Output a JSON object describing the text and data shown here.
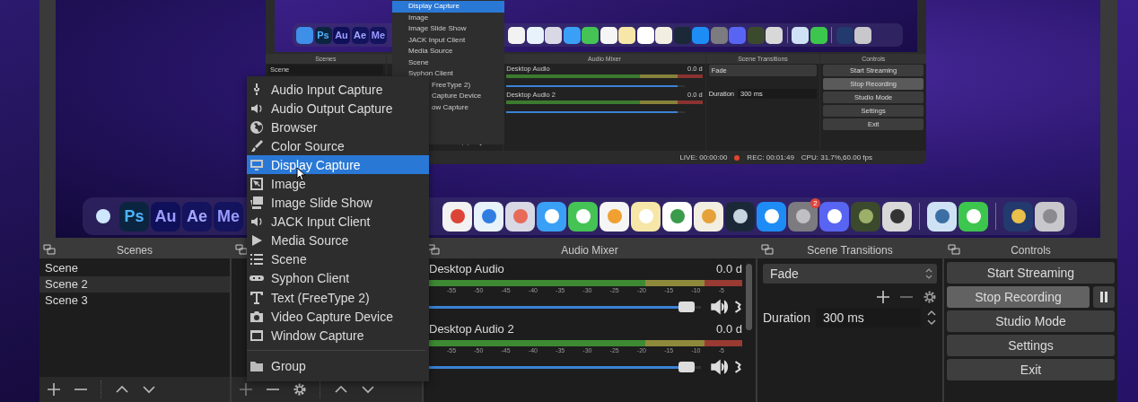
{
  "preview": {
    "dock": {
      "labels": [
        "Ps",
        "Au",
        "Ae",
        "Me"
      ],
      "badge": "2"
    },
    "captured_window": {
      "dock": {
        "labels": [
          "Ps",
          "Au",
          "Ae",
          "Me"
        ]
      },
      "menu": [
        {
          "label": "Display Capture",
          "selected": true
        },
        {
          "label": "Image",
          "selected": false
        },
        {
          "label": "Image Slide Show",
          "selected": false
        },
        {
          "label": "JACK Input Client",
          "selected": false
        },
        {
          "label": "Media Source",
          "selected": false
        },
        {
          "label": "Scene",
          "selected": false
        },
        {
          "label": "Syphon Client",
          "selected": false
        }
      ],
      "menu_covered_items": [
        "FreeType 2)",
        "Capture Device",
        "ow Capture"
      ],
      "scenes": {
        "title": "Scenes",
        "items": [
          "Scene"
        ]
      },
      "audio_mixer": {
        "title": "Audio Mixer",
        "channels": [
          {
            "name": "Desktop Audio",
            "reading": "0.0 d",
            "level": 0.96
          },
          {
            "name": "Desktop Audio 2",
            "reading": "0.0 d",
            "level": 0.96
          }
        ]
      },
      "scene_transitions": {
        "title": "Scene Transitions",
        "transition": "Fade",
        "duration_label": "Duration",
        "duration": "300 ms"
      },
      "controls": {
        "title": "Controls",
        "buttons": [
          {
            "label": "Start Streaming",
            "active": false
          },
          {
            "label": "Stop Recording",
            "active": true
          },
          {
            "label": "Studio Mode",
            "active": false
          },
          {
            "label": "Settings",
            "active": false
          },
          {
            "label": "Exit",
            "active": false
          }
        ]
      },
      "status_bar": {
        "live": "LIVE: 00:00:00",
        "rec": "REC: 00:01:49",
        "cpu": "CPU: 31.7%,60.00 fps"
      }
    }
  },
  "add_source_menu": {
    "items": [
      {
        "label": "Audio Input Capture",
        "selected": false
      },
      {
        "label": "Audio Output Capture",
        "selected": false
      },
      {
        "label": "Browser",
        "selected": false
      },
      {
        "label": "Color Source",
        "selected": false
      },
      {
        "label": "Display Capture",
        "selected": true
      },
      {
        "label": "Image",
        "selected": false
      },
      {
        "label": "Image Slide Show",
        "selected": false
      },
      {
        "label": "JACK Input Client",
        "selected": false
      },
      {
        "label": "Media Source",
        "selected": false
      },
      {
        "label": "Scene",
        "selected": false
      },
      {
        "label": "Syphon Client",
        "selected": false
      },
      {
        "label": "Text (FreeType 2)",
        "selected": false
      },
      {
        "label": "Video Capture Device",
        "selected": false
      },
      {
        "label": "Window Capture",
        "selected": false
      }
    ],
    "group_item": {
      "label": "Group",
      "selected": false
    }
  },
  "scenes": {
    "title": "Scenes",
    "items": [
      {
        "label": "Scene",
        "selected": false
      },
      {
        "label": "Scene 2",
        "selected": true
      },
      {
        "label": "Scene 3",
        "selected": false
      }
    ]
  },
  "audio_mixer": {
    "title": "Audio Mixer",
    "channels": [
      {
        "name": "Desktop Audio",
        "reading": "0.0 d",
        "level": 0.97,
        "scale": [
          "-55",
          "-50",
          "-45",
          "-40",
          "-35",
          "-30",
          "-25",
          "-20",
          "-15",
          "-10",
          "-5"
        ]
      },
      {
        "name": "Desktop Audio 2",
        "reading": "0.0 d",
        "level": 0.97,
        "scale": [
          "-55",
          "-50",
          "-45",
          "-40",
          "-35",
          "-30",
          "-25",
          "-20",
          "-15",
          "-10",
          "-5"
        ]
      }
    ]
  },
  "scene_transitions": {
    "title": "Scene Transitions",
    "transition": "Fade",
    "duration_label": "Duration",
    "duration": "300 ms"
  },
  "controls": {
    "title": "Controls",
    "buttons": [
      {
        "label": "Start Streaming",
        "active": false
      },
      {
        "label": "Stop Recording",
        "active": true
      },
      {
        "label": "Studio Mode",
        "active": false
      },
      {
        "label": "Settings",
        "active": false
      },
      {
        "label": "Exit",
        "active": false
      }
    ]
  }
}
